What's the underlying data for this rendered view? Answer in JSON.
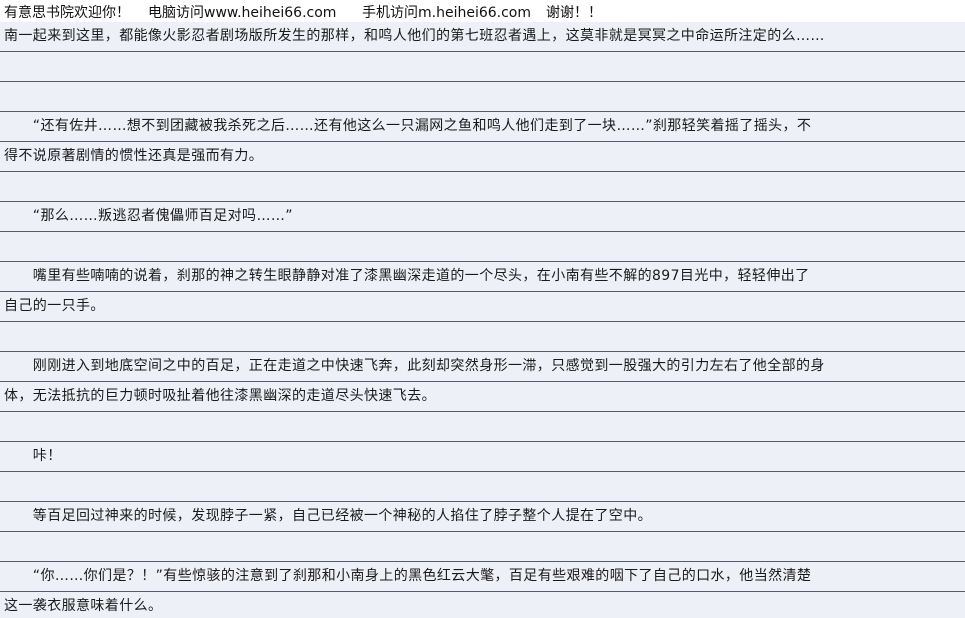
{
  "header": {
    "welcome": "有意思书院欢迎你！",
    "pc_visit": "电脑访问www.heihei66.com",
    "mobile_visit": "手机访问m.heihei66.com",
    "thanks": "谢谢！！"
  },
  "lines": [
    "南一起来到这里，都能像火影忍者剧场版所发生的那样，和鸣人他们的第七班忍者遇上，这莫非就是冥冥之中命运所注定的么……",
    "",
    "",
    "　　“还有佐井……想不到团藏被我杀死之后……还有他这么一只漏网之鱼和鸣人他们走到了一块……”刹那轻笑着摇了摇头，不",
    "得不说原著剧情的惯性还真是强而有力。",
    "",
    "　　“那么……叛逃忍者傀儡师百足对吗……”",
    "",
    "　　嘴里有些喃喃的说着，刹那的神之转生眼静静对准了漆黑幽深走道的一个尽头，在小南有些不解的897目光中，轻轻伸出了",
    "自己的一只手。",
    "",
    "　　刚刚进入到地底空间之中的百足，正在走道之中快速飞奔，此刻却突然身形一滞，只感觉到一股强大的引力左右了他全部的身",
    "体，无法抵抗的巨力顿时吸扯着他往漆黑幽深的走道尽头快速飞去。",
    "",
    "　　咔！",
    "",
    "　　等百足回过神来的时候，发现脖子一紧，自己已经被一个神秘的人掐住了脖子整个人提在了空中。",
    "",
    "　　“你……你们是？！”有些惊骇的注意到了刹那和小南身上的黑色红云大氅，百足有些艰难的咽下了自己的口水，他当然清楚",
    "这一袭衣服意味着什么。"
  ]
}
